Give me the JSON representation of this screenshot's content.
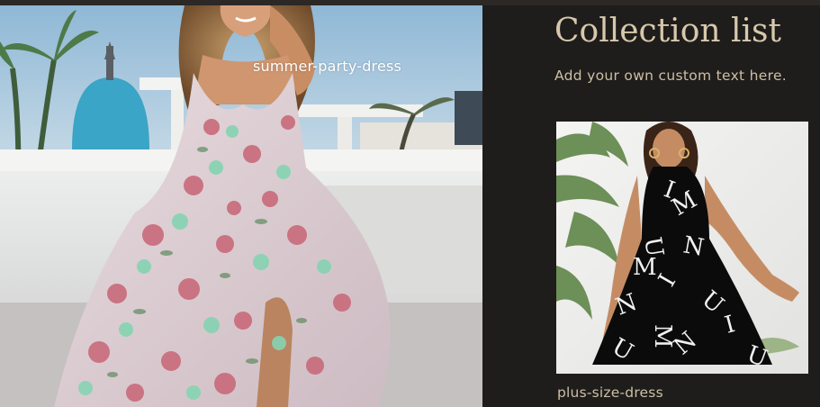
{
  "collections": [
    {
      "title": "summer-party-dress",
      "image_icon": "floral-maxi-dress-photo"
    },
    {
      "title": "plus-size-dress",
      "image_icon": "letter-print-halter-dress-photo"
    }
  ],
  "section": {
    "heading": "Collection list",
    "subheading": "Add your own custom text here."
  },
  "colors": {
    "background": "#1f1d1b",
    "heading": "#d7c8ad",
    "text": "#cdbfa6",
    "caption_on_image": "#ffffff"
  }
}
